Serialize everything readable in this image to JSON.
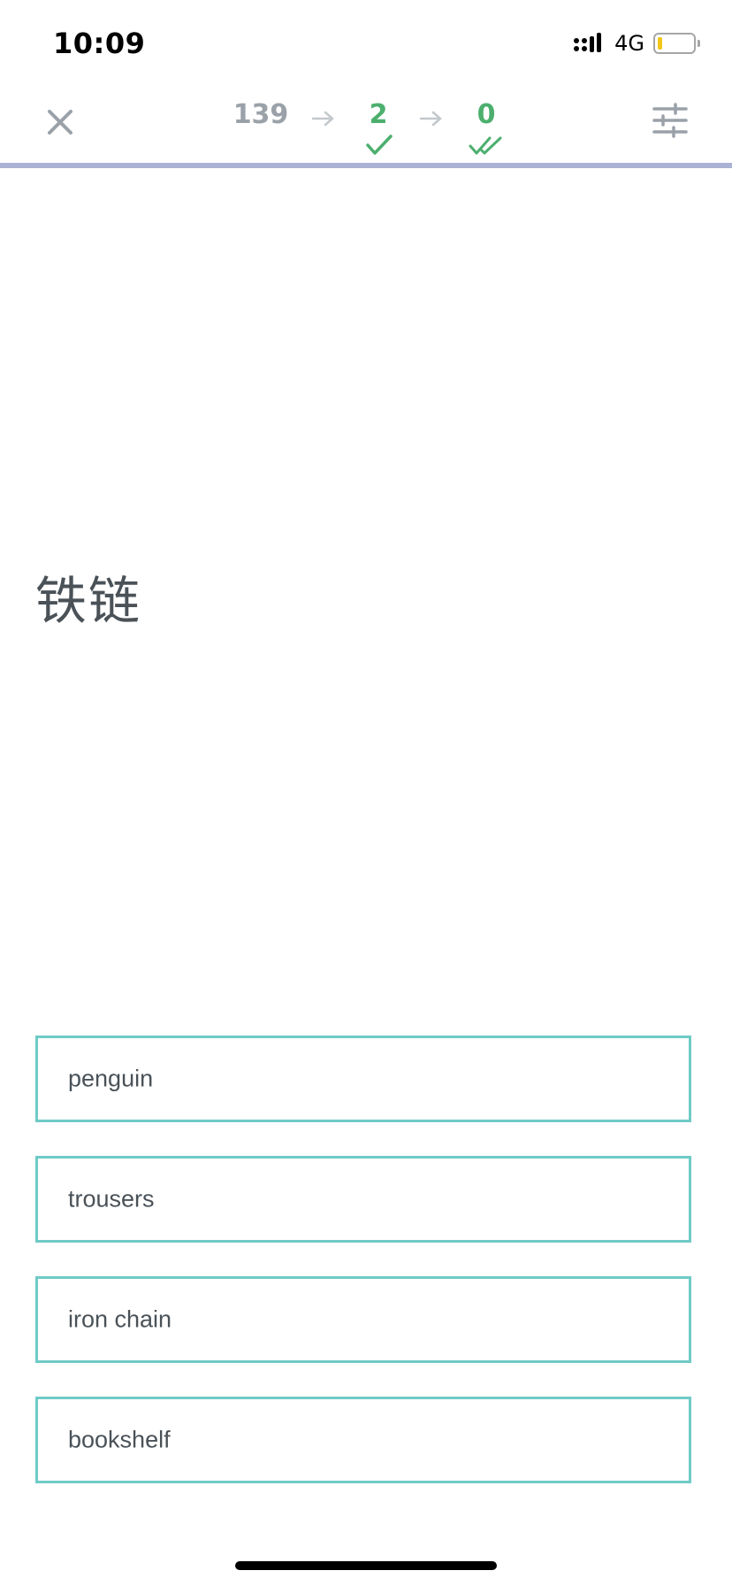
{
  "status_bar": {
    "time": "10:09",
    "network": "4G",
    "battery_color": "#f2c71a"
  },
  "header": {
    "close_icon": "close-icon",
    "settings_icon": "sliders-icon",
    "counts": {
      "new": "139",
      "learning": "2",
      "learned": "0"
    },
    "progress_color": "#aab3d4"
  },
  "question": {
    "prompt": "铁链"
  },
  "options": [
    {
      "label": "penguin"
    },
    {
      "label": "trousers"
    },
    {
      "label": "iron chain"
    },
    {
      "label": "bookshelf"
    }
  ],
  "colors": {
    "option_border": "#6fcac7",
    "success": "#4caf6e",
    "muted": "#9aa1a8"
  }
}
